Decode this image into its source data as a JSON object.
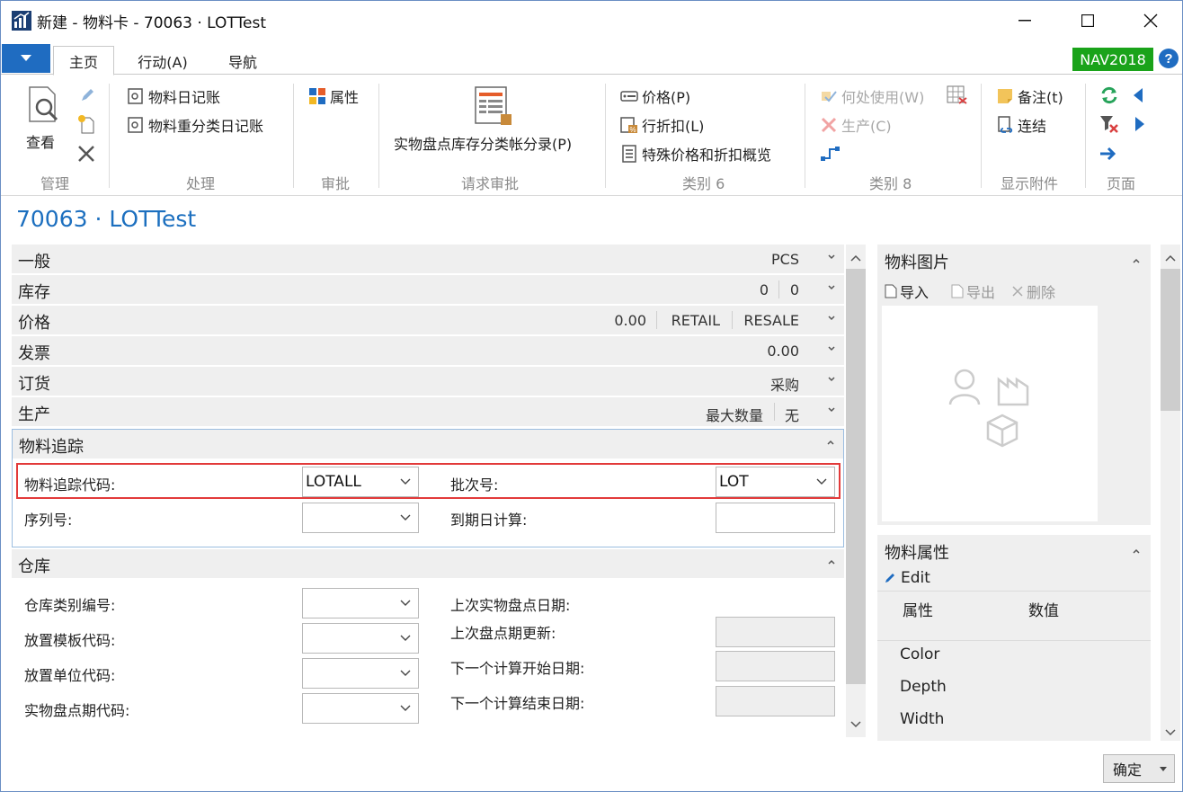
{
  "window": {
    "title": "新建 - 物料卡 - 70063 · LOTTest"
  },
  "tabs": [
    {
      "label": "主页"
    },
    {
      "label": "行动(A)"
    },
    {
      "label": "导航"
    }
  ],
  "badge": "NAV2018",
  "ribbon": {
    "manage": {
      "group_label": "管理",
      "view_label": "查看"
    },
    "process": {
      "group_label": "处理",
      "item_journal": "物料日记账",
      "reclass_journal": "物料重分类日记账"
    },
    "approval": {
      "group_label": "审批",
      "attributes": "属性"
    },
    "request_approval": {
      "group_label": "请求审批",
      "phys_inventory": "实物盘点库存分类帐分录(P)"
    },
    "category6": {
      "group_label": "类别 6",
      "prices": "价格(P)",
      "line_discounts": "行折扣(L)",
      "special_prices": "特殊价格和折扣概览"
    },
    "category8": {
      "group_label": "类别 8",
      "where_used": "何处使用(W)",
      "production": "生产(C)"
    },
    "attachments": {
      "group_label": "显示附件",
      "notes": "备注(t)",
      "links": "连结"
    },
    "page": {
      "group_label": "页面"
    }
  },
  "page_title": "70063 · LOTTest",
  "fasttabs": {
    "general": {
      "title": "一般",
      "value": "PCS"
    },
    "inventory": {
      "title": "库存",
      "values": [
        "0",
        "0"
      ]
    },
    "price": {
      "title": "价格",
      "values": [
        "0.00",
        "RETAIL",
        "RESALE"
      ]
    },
    "invoicing": {
      "title": "发票",
      "value": "0.00"
    },
    "replenishment": {
      "title": "订货",
      "value": "采购"
    },
    "production": {
      "title": "生产",
      "values": [
        "最大数量",
        "无"
      ]
    },
    "item_tracking": {
      "title": "物料追踪",
      "tracking_code_label": "物料追踪代码:",
      "tracking_code_value": "LOTALL",
      "lot_nos_label": "批次号:",
      "lot_nos_value": "LOT",
      "serial_nos_label": "序列号:",
      "serial_nos_value": "",
      "expiration_calc_label": "到期日计算:",
      "expiration_calc_value": ""
    },
    "warehouse": {
      "title": "仓库",
      "class_code_label": "仓库类别编号:",
      "put_away_template_label": "放置模板代码:",
      "put_away_uom_label": "放置单位代码:",
      "phys_invt_period_label": "实物盘点期代码:",
      "last_phys_invt_date_label": "上次实物盘点日期:",
      "last_counting_period_update_label": "上次盘点期更新:",
      "next_counting_start_label": "下一个计算开始日期:",
      "next_counting_end_label": "下一个计算结束日期:"
    }
  },
  "item_picture": {
    "title": "物料图片",
    "import": "导入",
    "export": "导出",
    "delete": "删除"
  },
  "item_attributes": {
    "title": "物料属性",
    "edit": "Edit",
    "col_attribute": "属性",
    "col_value": "数值",
    "rows": [
      "Color",
      "Depth",
      "Width"
    ]
  },
  "ok_button": "确定",
  "colors": {
    "accent": "#1c6fbf",
    "menu_button": "#1f6cc1",
    "badge": "#1aa31a",
    "highlight": "#e23a3a"
  }
}
